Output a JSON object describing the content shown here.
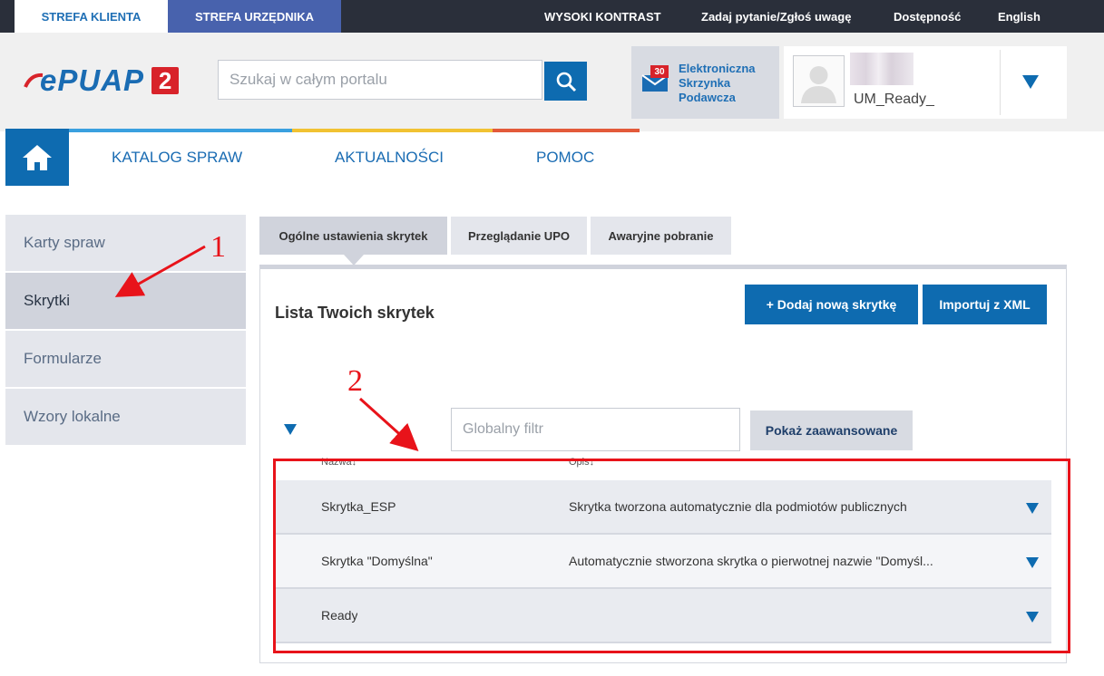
{
  "topbar": {
    "tabs": [
      "STREFA KLIENTA",
      "STREFA URZĘDNIKA"
    ],
    "links": [
      "WYSOKI KONTRAST",
      "Zadaj pytanie/Zgłoś uwagę",
      "Dostępność",
      "English"
    ]
  },
  "header": {
    "logo_text": "ePUAP",
    "logo_badge": "2",
    "search_placeholder": "Szukaj w całym portalu",
    "esp_badge": "30",
    "esp_label": "Elektroniczna Skrzynka Podawcza",
    "username": "UM_Ready_"
  },
  "nav": {
    "items": [
      "KATALOG SPRAW",
      "AKTUALNOŚCI",
      "POMOC"
    ],
    "line_colors": [
      "#3aa0df",
      "#f1c232",
      "#e35a3a"
    ]
  },
  "sidebar": {
    "items": [
      "Karty spraw",
      "Skrytki",
      "Formularze",
      "Wzory lokalne"
    ],
    "active_index": 1
  },
  "tabs": {
    "items": [
      "Ogólne ustawienia skrytek",
      "Przeglądanie UPO",
      "Awaryjne pobranie"
    ],
    "active_index": 0
  },
  "panel": {
    "title": "Lista Twoich skrytek",
    "add_button": "+  Dodaj nową skrytkę",
    "import_button": "Importuj z XML",
    "filter_placeholder": "Globalny filtr",
    "advanced_button": "Pokaż zaawansowane",
    "columns": [
      "Nazwa↓",
      "Opis↓"
    ],
    "rows": [
      {
        "name": "Skrytka_ESP",
        "desc": "Skrytka tworzona automatycznie dla podmiotów publicznych"
      },
      {
        "name": "Skrytka \"Domyślna\"",
        "desc": "Automatycznie stworzona skrytka o pierwotnej nazwie \"Domyśl..."
      },
      {
        "name": "Ready",
        "desc": ""
      }
    ]
  },
  "annotations": {
    "label_1": "1",
    "label_2": "2",
    "color": "#e8131a"
  }
}
